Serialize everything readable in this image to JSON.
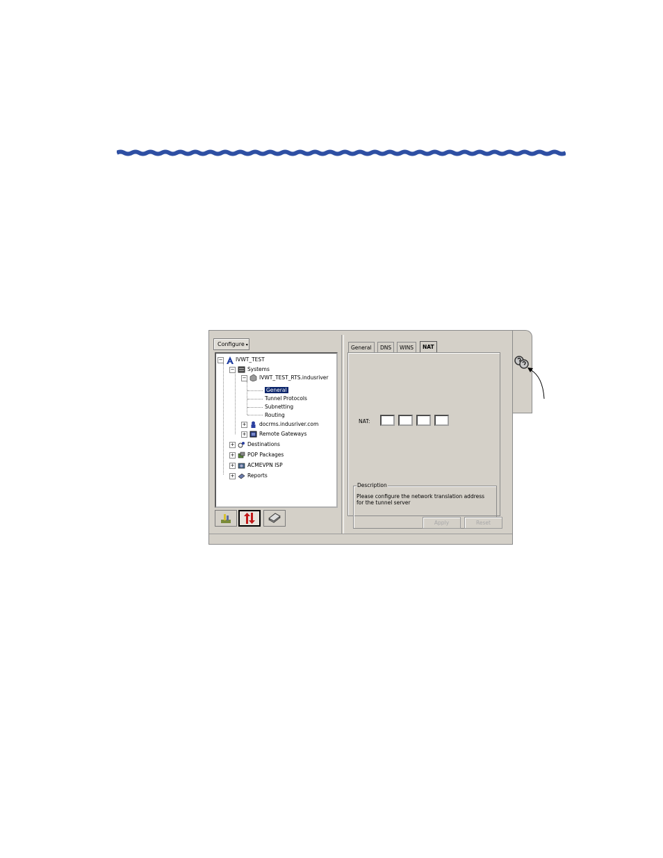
{
  "toolbar": {
    "configure_label": "Configure",
    "configure_arrow": "▾"
  },
  "tree": {
    "root": "IVWT_TEST",
    "systems": "Systems",
    "system_node": "IVWT_TEST_RTS.indusriver",
    "general": "General",
    "tunnel_protocols": "Tunnel Protocols",
    "subnetting": "Subnetting",
    "routing": "Routing",
    "docrms": "docrms.indusriver.com",
    "remote_gateways": "Remote Gateways",
    "destinations": "Destinations",
    "pop_packages": "POP Packages",
    "acmevpn_isp": "ACMEVPN ISP",
    "reports": "Reports",
    "expand": "+",
    "collapse": "−"
  },
  "tabs": [
    "General",
    "DNS",
    "WINS",
    "NAT"
  ],
  "nat": {
    "label": "NAT:",
    "octets": [
      "",
      "",
      "",
      ""
    ]
  },
  "description": {
    "title": "Description",
    "text": "Please configure the network translation address for the tunnel server"
  },
  "buttons": {
    "apply": "Apply",
    "reset": "Reset"
  },
  "colors": {
    "accent_wave": "#2e4fa3",
    "selection": "#0a246a",
    "window_bg": "#d4d0c8"
  },
  "icons": {
    "nav_tab_1": "configure-icon",
    "nav_tab_2": "transfer-arrows-icon",
    "nav_tab_3": "reports-icon",
    "help": "help-icon"
  }
}
